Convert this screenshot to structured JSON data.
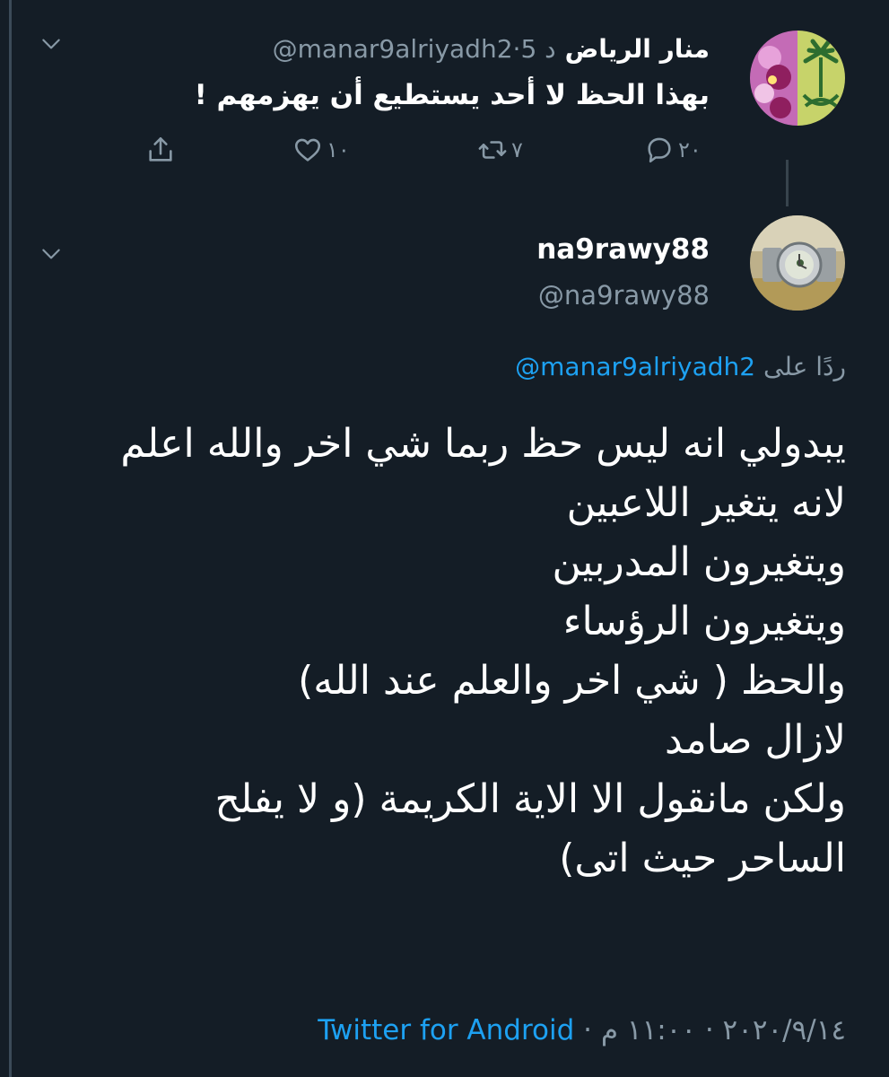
{
  "colors": {
    "background": "#141d26",
    "text_primary": "#ffffff",
    "text_secondary": "#8899a6",
    "link": "#1da1f2",
    "thread_line": "#38444d"
  },
  "tweet_1": {
    "display_name": "منار الرياض",
    "handle": "@manar9alriyadh2",
    "time_ago": "5 د",
    "text": "بهذا الحظ لا أحد يستطيع أن يهزمهم !",
    "avatar_icon": "palm-swords-emblem-avatar",
    "actions": {
      "reply_count": "٢٠",
      "retweet_count": "٧",
      "like_count": "١٠"
    }
  },
  "tweet_2": {
    "display_name": "na9rawy88",
    "handle": "@na9rawy88",
    "avatar_icon": "watch-photo-avatar",
    "reply_to_label": "ردًا على",
    "reply_to_handle": "@manar9alriyadh2",
    "lines": [
      "يبدولي انه ليس حظ ربما شي اخر والله اعلم",
      "لانه يتغير اللاعبين",
      "ويتغيرون المدربين",
      "ويتغيرون الرؤساء",
      "والحظ ( شي اخر والعلم عند الله)",
      "لازال صامد",
      "ولكن مانقول الا الاية الكريمة (و لا يفلح",
      "الساحر حيث اتى)"
    ],
    "date": "٢٠٢٠/٩/١٤",
    "time": "١١:٠٠ م",
    "source": "Twitter for Android"
  }
}
